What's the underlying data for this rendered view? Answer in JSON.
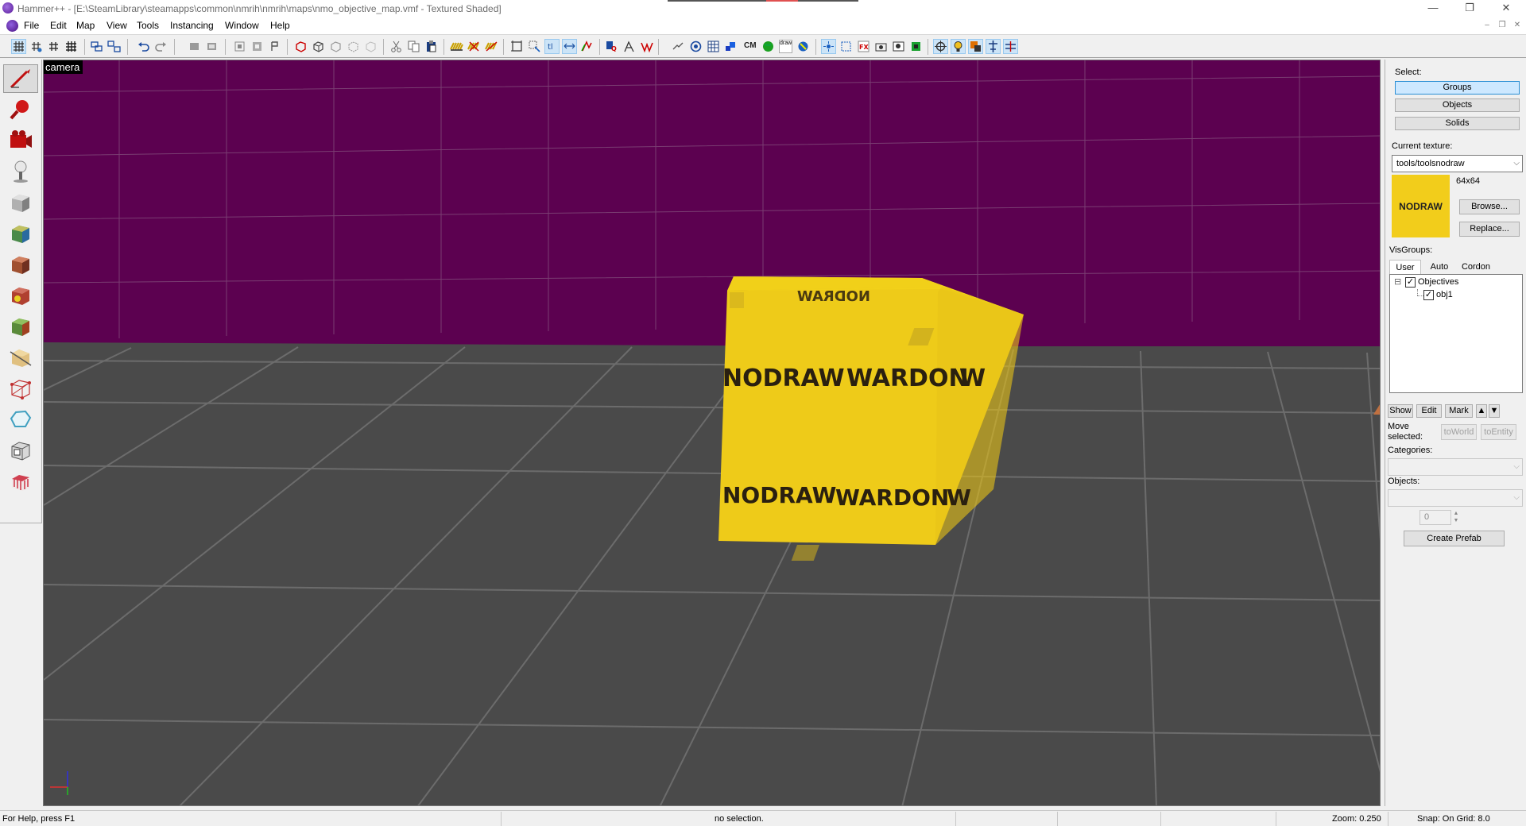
{
  "window": {
    "title": "Hammer++ - [E:\\SteamLibrary\\steamapps\\common\\nmrih\\nmrih\\maps\\nmo_objective_map.vmf - Textured Shaded]",
    "controls": {
      "minimize": "—",
      "maximize": "❐",
      "close": "✕"
    }
  },
  "menubar": {
    "items": [
      "File",
      "Edit",
      "Map",
      "View",
      "Tools",
      "Instancing",
      "Window",
      "Help"
    ],
    "mdi_controls": {
      "minimize": "–",
      "restore": "❐",
      "close": "✕"
    }
  },
  "toolbar": {
    "cm_label": "CM",
    "draw_label": "draw"
  },
  "tools": {
    "items": [
      {
        "name": "selection-tool",
        "active": true
      },
      {
        "name": "magnify-tool",
        "active": false
      },
      {
        "name": "camera-tool",
        "active": false
      },
      {
        "name": "entity-tool",
        "active": false
      },
      {
        "name": "block-tool",
        "active": false
      },
      {
        "name": "texture-application-tool",
        "active": false
      },
      {
        "name": "apply-current-texture-tool",
        "active": false
      },
      {
        "name": "decal-tool",
        "active": false
      },
      {
        "name": "overlay-tool",
        "active": false
      },
      {
        "name": "clipping-tool",
        "active": false
      },
      {
        "name": "vertex-tool",
        "active": false
      },
      {
        "name": "path-tool",
        "active": false
      },
      {
        "name": "cordon-tool",
        "active": false
      },
      {
        "name": "sprinkle-tool",
        "active": false
      }
    ]
  },
  "viewport": {
    "label": "camera",
    "mode": "Textured Shaded",
    "object_texture_text": "NODRAW",
    "colors": {
      "sky": "#5c0150",
      "floor": "#4a4a4a",
      "grid": "#6a6a6a",
      "block": "#f0cf1a"
    }
  },
  "panel": {
    "select_label": "Select:",
    "select_buttons": [
      {
        "label": "Groups",
        "selected": true
      },
      {
        "label": "Objects",
        "selected": false
      },
      {
        "label": "Solids",
        "selected": false
      }
    ],
    "current_texture_label": "Current texture:",
    "current_texture_value": "tools/toolsnodraw",
    "texture_preview_text": "NODRAW",
    "texture_size": "64x64",
    "browse_button": "Browse...",
    "replace_button": "Replace...",
    "visgroups_label": "VisGroups:",
    "tabs": [
      {
        "label": "User",
        "selected": true
      },
      {
        "label": "Auto",
        "selected": false
      },
      {
        "label": "Cordon",
        "selected": false
      }
    ],
    "tree": {
      "root": {
        "label": "Objectives",
        "checked": true,
        "expander": "⊟"
      },
      "children": [
        {
          "label": "obj1",
          "checked": true
        }
      ]
    },
    "show_button": "Show",
    "edit_button": "Edit",
    "mark_button": "Mark",
    "up_arrow": "▲",
    "down_arrow": "▼",
    "move_selected_label_1": "Move",
    "move_selected_label_2": "selected:",
    "to_world_button": "toWorld",
    "to_entity_button": "toEntity",
    "categories_label": "Categories:",
    "categories_value": "",
    "objects_label": "Objects:",
    "objects_value": "",
    "count_value": "0",
    "create_prefab_button": "Create Prefab"
  },
  "statusbar": {
    "help": "For Help, press F1",
    "selection": "no selection.",
    "zoom": "Zoom: 0.250",
    "snap": "Snap: On Grid: 8.0"
  }
}
